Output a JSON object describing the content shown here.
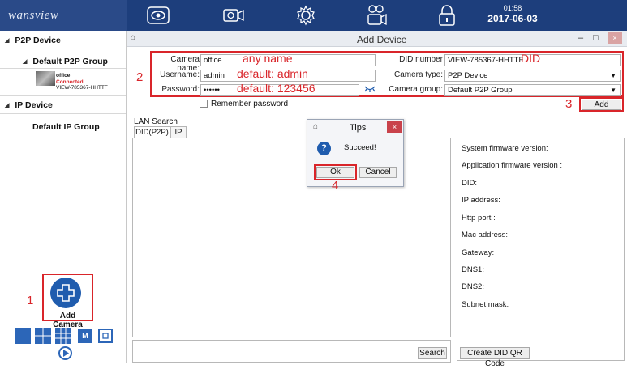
{
  "app": {
    "logo": "wansview"
  },
  "clock": {
    "time": "01:58",
    "date": "2017-06-03"
  },
  "nav_icons": [
    "eye-icon",
    "video-camera-icon",
    "gear-icon",
    "camera-group-icon",
    "lock-icon"
  ],
  "sidebar": {
    "p2p_device": "P2P Device",
    "default_p2p_group": "Default P2P Group",
    "camera": {
      "name": "office",
      "status": "Connected",
      "did": "VIEW-785367-HHTTF"
    },
    "ip_device": "IP Device",
    "default_ip_group": "Default IP Group",
    "add_camera": "Add Camera",
    "view_buttons": [
      "M"
    ]
  },
  "window": {
    "title": "Add Device"
  },
  "form": {
    "camera_name_label": "Camera name:",
    "camera_name_value": "office",
    "username_label": "Username:",
    "username_value": "admin",
    "password_label": "Password:",
    "password_value": "••••••",
    "remember_password": "Remember password",
    "did_label": "DID number",
    "did_value": "VIEW-785367-HHTTF",
    "camera_type_label": "Camera type:",
    "camera_type_value": "P2P Device",
    "camera_group_label": "Camera group:",
    "camera_group_value": "Default P2P Group",
    "add_button": "Add"
  },
  "annotations": {
    "any_name": "any name",
    "default_admin": "default: admin",
    "default_password": "default: 123456",
    "did": "DID",
    "step1": "1",
    "step2": "2",
    "step3": "3",
    "step4": "4"
  },
  "lan_search": {
    "label": "LAN Search",
    "tabs": [
      "DID(P2P)",
      "IP"
    ],
    "search_button": "Search",
    "qr_button": "Create DID QR Code"
  },
  "info": {
    "system_fw": "System firmware version:",
    "app_fw": "Application firmware version :",
    "did": "DID:",
    "ip": "IP address:",
    "http_port": "Http port :",
    "mac": "Mac address:",
    "gateway": "Gateway:",
    "dns1": "DNS1:",
    "dns2": "DNS2:",
    "subnet": "Subnet mask:"
  },
  "dialog": {
    "title": "Tips",
    "message": "Succeed!",
    "ok": "Ok",
    "cancel": "Cancel"
  },
  "colors": {
    "topbar": "#1d3e7c",
    "accent": "#1f5cae",
    "annotation_red": "#d9252a"
  }
}
